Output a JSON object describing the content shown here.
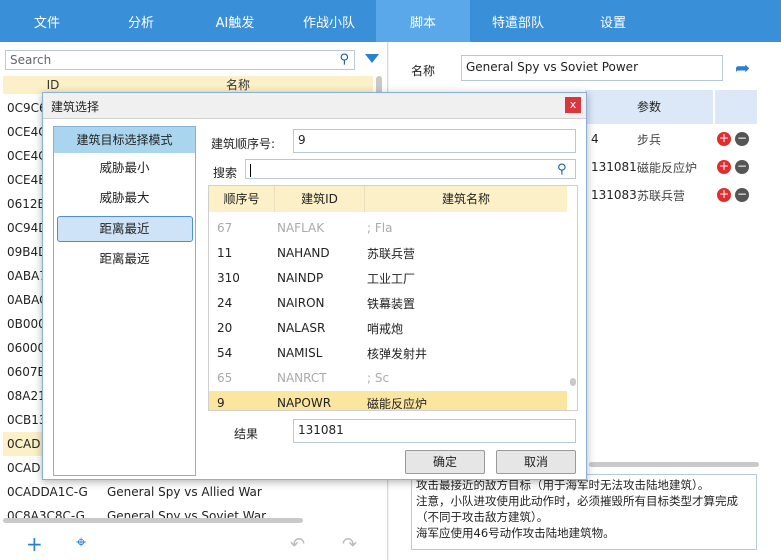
{
  "nav": {
    "tabs": [
      "文件",
      "分析",
      "AI触发",
      "作战小队",
      "脚本",
      "特遣部队",
      "设置"
    ],
    "active": 4
  },
  "left": {
    "search_placeholder": "Search",
    "col_id": "ID",
    "col_name": "名称",
    "rows": [
      {
        "id": "0C9C6",
        "name": ""
      },
      {
        "id": "0CE4C",
        "name": ""
      },
      {
        "id": "0CE4C",
        "name": ""
      },
      {
        "id": "0CE4E",
        "name": ""
      },
      {
        "id": "0612E",
        "name": ""
      },
      {
        "id": "0C94D",
        "name": ""
      },
      {
        "id": "09B4D",
        "name": ""
      },
      {
        "id": "0ABA7",
        "name": ""
      },
      {
        "id": "0ABAC",
        "name": ""
      },
      {
        "id": "0B000",
        "name": ""
      },
      {
        "id": "06000",
        "name": ""
      },
      {
        "id": "0607E",
        "name": ""
      },
      {
        "id": "08A21",
        "name": ""
      },
      {
        "id": "0CB13",
        "name": ""
      },
      {
        "id": "0CAD",
        "name": ""
      },
      {
        "id": "0CAD",
        "name": ""
      },
      {
        "id": "0CADDA1C-G",
        "name": "General Spy vs Allied War"
      },
      {
        "id": "0C8A3C8C-G",
        "name": "General Spy vs Soviet War"
      }
    ],
    "selected_index": 14
  },
  "right": {
    "name_label": "名称",
    "name_value": "General Spy vs Soviet Power",
    "params_header": "参数",
    "params": [
      {
        "value": "4",
        "type": "步兵"
      },
      {
        "value": "131081",
        "type": "磁能反应炉"
      },
      {
        "value": "131083",
        "type": "苏联兵营"
      }
    ],
    "description": "攻击最接近的敌方目标（用于海军时无法攻击陆地建筑）。\n注意，小队进攻使用此动作时，必须摧毁所有目标类型才算完成（不同于攻击敌方建筑）。\n海军应使用46号动作攻击陆地建筑物。"
  },
  "dialog": {
    "title": "建筑选择",
    "close": "x",
    "modes_header": "建筑目标选择模式",
    "modes": [
      "威胁最小",
      "威胁最大",
      "距离最近",
      "距离最远"
    ],
    "selected_mode": 2,
    "index_label": "建筑顺序号:",
    "index_value": "9",
    "search_label": "搜索",
    "col_seq": "顺序号",
    "col_bid": "建筑ID",
    "col_bname": "建筑名称",
    "buildings": [
      {
        "seq": "67",
        "bid": "NAFLAK",
        "bname": "; Fla",
        "faded": true
      },
      {
        "seq": "11",
        "bid": "NAHAND",
        "bname": "苏联兵营",
        "faded": false
      },
      {
        "seq": "310",
        "bid": "NAINDP",
        "bname": "工业工厂",
        "faded": false
      },
      {
        "seq": "24",
        "bid": "NAIRON",
        "bname": "铁幕装置",
        "faded": false
      },
      {
        "seq": "20",
        "bid": "NALASR",
        "bname": "哨戒炮",
        "faded": false
      },
      {
        "seq": "54",
        "bid": "NAMISL",
        "bname": "核弹发射井",
        "faded": false
      },
      {
        "seq": "65",
        "bid": "NANRCT",
        "bname": "; Sc",
        "faded": true
      },
      {
        "seq": "9",
        "bid": "NAPOWR",
        "bname": "磁能反应炉",
        "faded": false
      }
    ],
    "selected_building": 7,
    "result_label": "结果",
    "result_value": "131081",
    "ok": "确定",
    "cancel": "取消"
  }
}
